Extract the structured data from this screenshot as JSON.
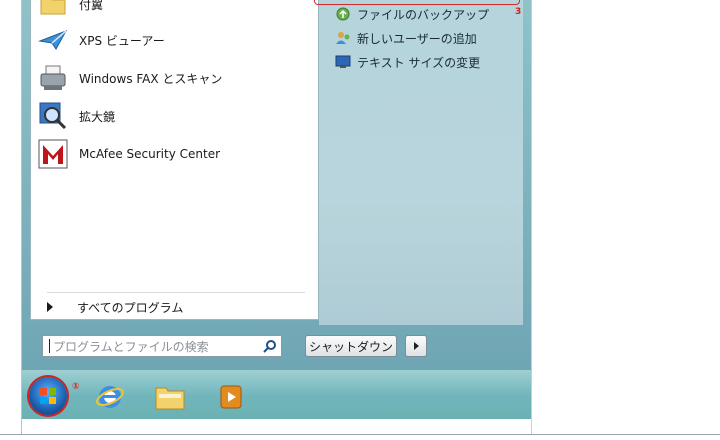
{
  "programs": [
    {
      "label": "付翼",
      "icon": "folder-icon"
    },
    {
      "label": "XPS ビューアー",
      "icon": "xps-viewer-icon"
    },
    {
      "label": "Windows FAX とスキャン",
      "icon": "fax-scanner-icon"
    },
    {
      "label": "拡大鏡",
      "icon": "magnifier-icon"
    },
    {
      "label": "McAfee Security Center",
      "icon": "mcafee-icon"
    }
  ],
  "right_links": [
    {
      "label": "ファイルのバックアップ",
      "icon": "backup-icon"
    },
    {
      "label": "新しいユーザーの追加",
      "icon": "add-user-icon"
    },
    {
      "label": "テキスト サイズの変更",
      "icon": "display-icon"
    }
  ],
  "all_programs_label": "すべてのプログラム",
  "search": {
    "placeholder": "プログラムとファイルの検索"
  },
  "shutdown_label": "シャットダウン",
  "markers": {
    "step3": "3",
    "step1": "①"
  },
  "colors": {
    "highlight": "#cc2222",
    "mcafee": "#c0141b"
  }
}
